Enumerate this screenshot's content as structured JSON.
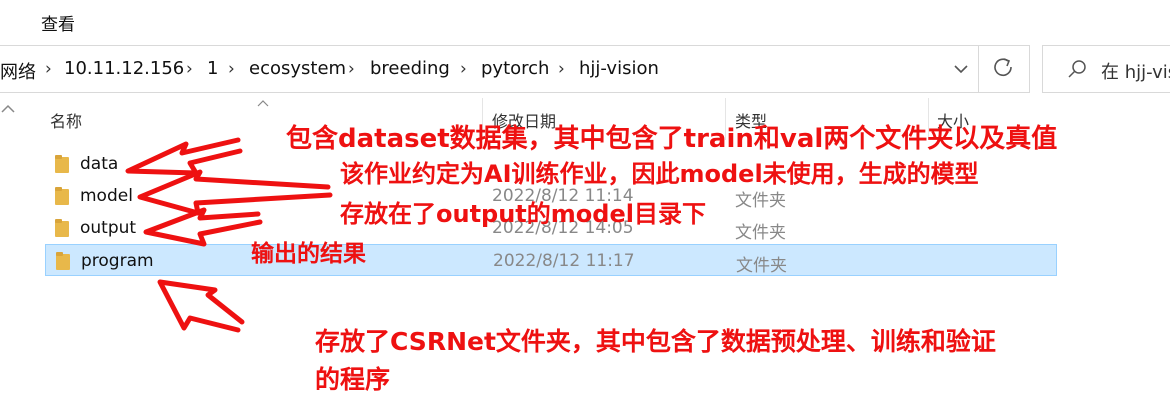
{
  "menu": {
    "view_label": "查看"
  },
  "address": {
    "crumbs": [
      "网络",
      "10.11.12.156",
      "1",
      "ecosystem",
      "breeding",
      "pytorch",
      "hjj-vision"
    ],
    "separator": "›"
  },
  "search": {
    "placeholder": "在 hjj-vision"
  },
  "columns": {
    "name": "名称",
    "date": "修改日期",
    "type": "类型",
    "size": "大小"
  },
  "files": [
    {
      "name": "data",
      "date": "",
      "type": ""
    },
    {
      "name": "model",
      "date": "2022/8/12 11:14",
      "type": "文件夹"
    },
    {
      "name": "output",
      "date": "2022/8/12 14:05",
      "type": "文件夹"
    },
    {
      "name": "program",
      "date": "2022/8/12 11:17",
      "type": "文件夹"
    }
  ],
  "annotations": {
    "data_note": "包含dataset数据集，其中包含了train和val两个文件夹以及真值",
    "model_note_1": "该作业约定为AI训练作业，因此model未使用，生成的模型",
    "model_note_2": "存放在了output的model目录下",
    "output_note": "输出的结果",
    "program_note_1": "存放了CSRNet文件夹，其中包含了数据预处理、训练和验证",
    "program_note_2": "的程序"
  },
  "colors": {
    "annotation": "#ee1111",
    "selection": "#cce8ff",
    "folder": "#e8b84a"
  }
}
